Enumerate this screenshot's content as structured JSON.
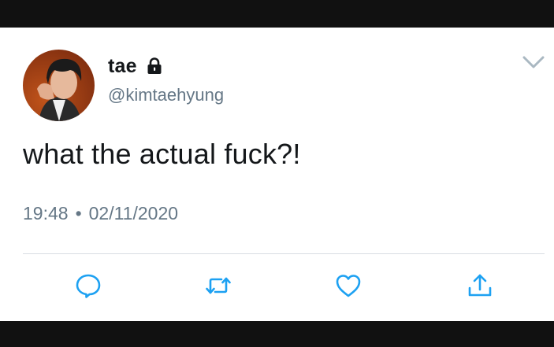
{
  "tweet": {
    "display_name": "tae",
    "handle": "@kimtaehyung",
    "text": "what the actual fuck?!",
    "time": "19:48",
    "separator": "•",
    "date": "02/11/2020",
    "protected": true
  },
  "icons": {
    "lock": "lock-icon",
    "menu": "chevron-down-icon",
    "reply": "reply-icon",
    "retweet": "retweet-icon",
    "like": "heart-icon",
    "share": "share-icon"
  },
  "colors": {
    "text_primary": "#14171a",
    "text_secondary": "#657786",
    "icon": "#1da1f2",
    "caret": "#aab8c2",
    "divider": "#d8dde2",
    "letterbox": "#111111"
  }
}
